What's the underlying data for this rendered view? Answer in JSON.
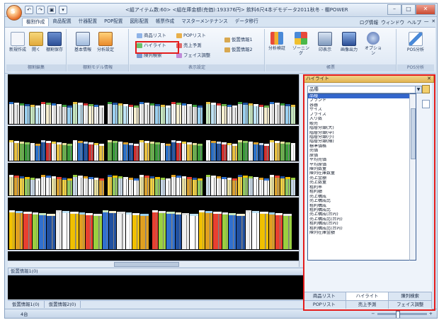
{
  "window": {
    "title": "<組アイテム数:60> <組在庫金額(売価):193376円> 飲料6尺4本デモデータ2011秋冬 - 棚POWER",
    "app_button_label": "S",
    "qat": [
      "↶",
      "↷",
      "▣",
      "▾"
    ],
    "controls": {
      "minimize": "–",
      "maximize": "□",
      "close": "✕"
    }
  },
  "menu": {
    "tabs": [
      "棚割作成",
      "商品配置",
      "什器配置",
      "POP配置",
      "図形配置",
      "帳票作成",
      "マスターメンテナンス",
      "データ移行"
    ],
    "right": [
      "ログ情報",
      "ウィンドウ",
      "ヘルプ",
      "—",
      "✕"
    ]
  },
  "ribbon": {
    "groups": [
      {
        "label": "棚割編集",
        "buttons": [
          "新規作成",
          "開く",
          "棚割保存"
        ]
      },
      {
        "label": "棚割モデル情報",
        "buttons": [
          "基本情報",
          "分析設定"
        ]
      },
      {
        "label": "表示設定",
        "small": [
          "商品リスト",
          "POPリスト",
          "ハイライト",
          "売上予測",
          "陳列検索",
          "フェイス調整",
          "仮置情報1",
          "仮置情報2"
        ]
      },
      {
        "label": "帳票",
        "buttons": [
          "分析検証",
          "ゾーニング",
          "印表示",
          "画像出力",
          "オプション"
        ]
      },
      {
        "label": "POS分析",
        "buttons": [
          "POS分析"
        ]
      }
    ]
  },
  "panels": {
    "temp1": "仮置情報1(0)",
    "bottom_tabs": [
      "仮置情報1(0)",
      "仮置情報2(0)"
    ]
  },
  "status": {
    "text": "4台",
    "zoom_minus": "−",
    "zoom_plus": "+"
  },
  "highlight_pane": {
    "title": "ハイライト",
    "close": "✕",
    "dropdown_value": "品種",
    "items": [
      "品種",
      "ブランド",
      "容器",
      "サイズ",
      "プライス",
      "入り数",
      "販売",
      "階層分類(大)",
      "階層分類(中)",
      "階層分類(小)",
      "階層分類(細)",
      "標準価格",
      "売価",
      "原価",
      "平均売価",
      "平均原価",
      "陳列数量",
      "陳列在庫数量",
      "売上金額",
      "売上数量",
      "粗利率",
      "粗利額",
      "売上構成",
      "売上構成比",
      "粗利構成",
      "粗利構成比",
      "売上構成(台内)",
      "売上構成比(台内)",
      "粗利構成(台内)",
      "粗利構成比(台内)",
      "陳列在庫金額"
    ],
    "selected_index": 0,
    "tabs_row1": [
      "商品リスト",
      "ハイライト",
      "陳列検索"
    ],
    "tabs_row2": [
      "POPリスト",
      "売上予測",
      "フェイス調整"
    ],
    "active_tab": "ハイライト"
  },
  "colors": {
    "highlight": "#e41c1c",
    "selection": "#3366cc",
    "pane_header": "#e2b552"
  }
}
